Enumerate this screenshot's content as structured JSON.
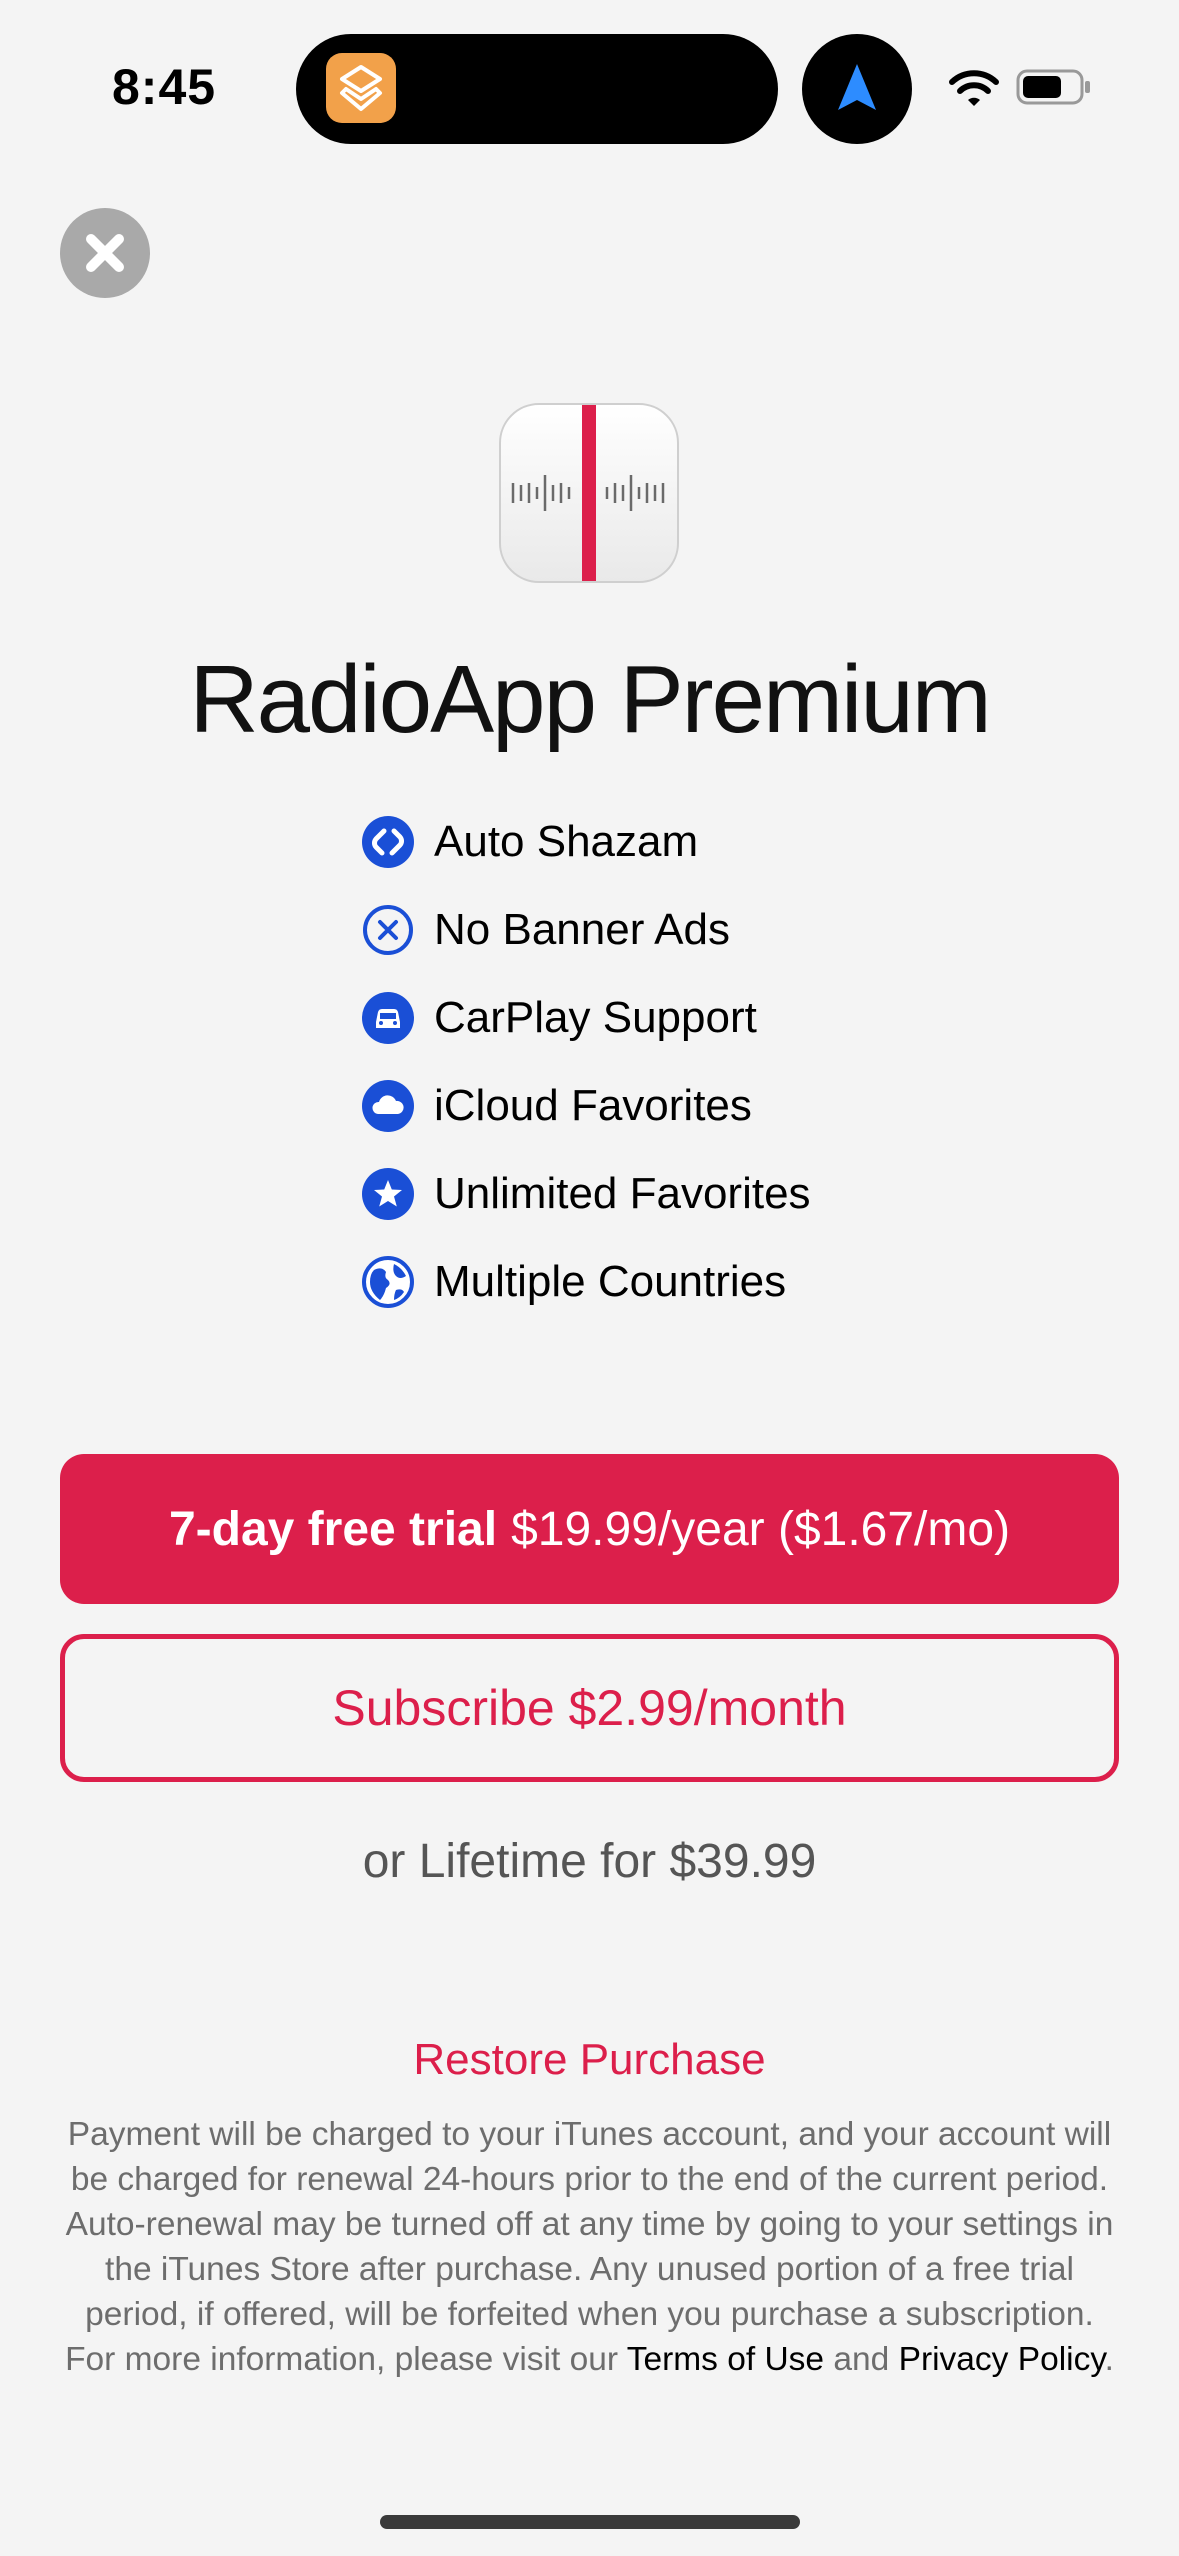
{
  "status_bar": {
    "time": "8:45",
    "island_app_icon": "shortcuts-icon",
    "location_icon": "navigation-arrow-icon",
    "wifi_icon": "wifi-icon",
    "battery_icon": "battery-icon"
  },
  "close_icon": "close-icon",
  "app_icon": "radio-tuner-icon",
  "title": "RadioApp Premium",
  "features": [
    {
      "icon": "shazam-icon",
      "label": "Auto Shazam"
    },
    {
      "icon": "no-ads-icon",
      "label": "No Banner Ads"
    },
    {
      "icon": "car-icon",
      "label": "CarPlay Support"
    },
    {
      "icon": "cloud-icon",
      "label": "iCloud Favorites"
    },
    {
      "icon": "star-icon",
      "label": "Unlimited Favorites"
    },
    {
      "icon": "globe-icon",
      "label": "Multiple Countries"
    }
  ],
  "trial_button": {
    "bold": "7-day free trial",
    "price": "$19.99/year ($1.67/mo)"
  },
  "subscribe_button": "Subscribe $2.99/month",
  "lifetime": "or Lifetime for $39.99",
  "restore": "Restore Purchase",
  "legal": {
    "text": "Payment will be charged to your iTunes account, and your account will be charged for renewal 24-hours prior to the end of the current period. Auto-renewal may be turned off at any time by going to your settings in the iTunes Store after purchase. Any unused portion of a free trial period, if offered, will be forfeited when you purchase a subscription. For more information, please visit our",
    "terms": "Terms of Use",
    "and": "and",
    "privacy": "Privacy Policy",
    "period": "."
  },
  "colors": {
    "accent": "#dc1f4b",
    "feature_icon": "#1a4fd6",
    "background": "#f4f4f4"
  }
}
